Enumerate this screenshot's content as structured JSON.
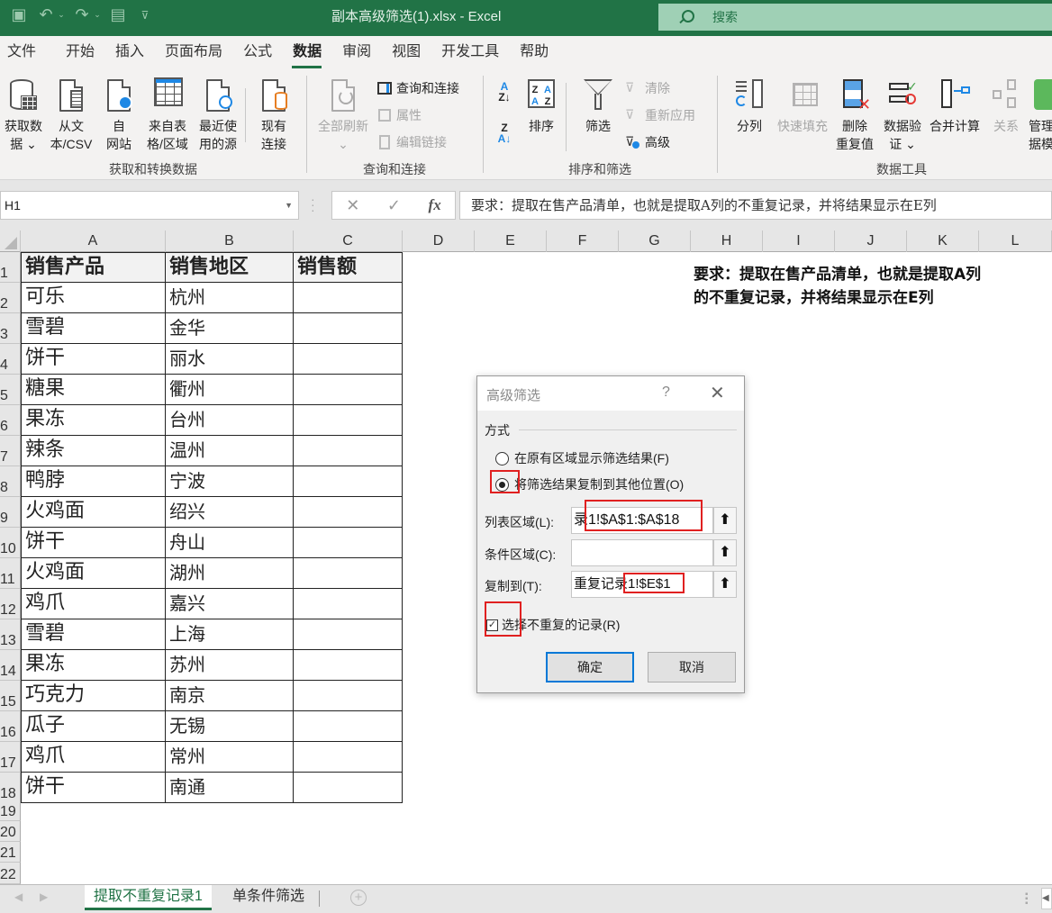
{
  "titlebar": {
    "title": "副本高级筛选(1).xlsx  -  Excel",
    "search_placeholder": "搜索",
    "qat": {
      "save": "save-icon",
      "undo": "undo-icon",
      "redo": "redo-icon",
      "form": "form-icon",
      "customize": "customize-qat-icon"
    }
  },
  "menu": {
    "tabs": [
      "文件",
      "开始",
      "插入",
      "页面布局",
      "公式",
      "数据",
      "审阅",
      "视图",
      "开发工具",
      "帮助"
    ],
    "active": "数据"
  },
  "ribbon": {
    "groups": [
      {
        "label": "获取和转换数据",
        "buttons": [
          {
            "line1": "获取数",
            "line2": "据 ⌄",
            "icon": "database-icon"
          },
          {
            "line1": "从文",
            "line2": "本/CSV",
            "icon": "text-file-icon"
          },
          {
            "line1": "自",
            "line2": "网站",
            "icon": "web-icon"
          },
          {
            "line1": "来自表",
            "line2": "格/区域",
            "icon": "table-icon"
          },
          {
            "line1": "最近使",
            "line2": "用的源",
            "icon": "recent-sources-icon"
          },
          {
            "line1": "现有",
            "line2": "连接",
            "icon": "existing-connections-icon"
          }
        ]
      },
      {
        "label": "查询和连接",
        "buttons": [
          {
            "line1": "全部刷新",
            "line2": "⌄",
            "icon": "refresh-all-icon",
            "disabled": true
          }
        ],
        "small": [
          {
            "label": "查询和连接",
            "icon": "queries-pane-icon",
            "disabled": false
          },
          {
            "label": "属性",
            "icon": "properties-icon",
            "disabled": true
          },
          {
            "label": "编辑链接",
            "icon": "edit-links-icon",
            "disabled": true
          }
        ]
      },
      {
        "label": "排序和筛选",
        "buttons": [
          {
            "line1": "排序",
            "line2": "",
            "icon": "sort-icon"
          },
          {
            "line1": "筛选",
            "line2": "",
            "icon": "filter-icon"
          }
        ],
        "small": [
          {
            "label": "清除",
            "icon": "clear-filter-icon",
            "disabled": true
          },
          {
            "label": "重新应用",
            "icon": "reapply-icon",
            "disabled": true
          },
          {
            "label": "高级",
            "icon": "advanced-filter-icon",
            "disabled": false
          }
        ],
        "sort_asc": "A→Z",
        "sort_desc": "Z→A"
      },
      {
        "label": "数据工具",
        "buttons": [
          {
            "line1": "分列",
            "line2": "",
            "icon": "text-to-columns-icon"
          },
          {
            "line1": "快速填充",
            "line2": "",
            "icon": "flash-fill-icon",
            "disabled": true
          },
          {
            "line1": "删除",
            "line2": "重复值",
            "icon": "remove-duplicates-icon"
          },
          {
            "line1": "数据验",
            "line2": "证 ⌄",
            "icon": "data-validation-icon"
          },
          {
            "line1": "合并计算",
            "line2": "",
            "icon": "consolidate-icon"
          },
          {
            "line1": "关系",
            "line2": "",
            "icon": "relationships-icon",
            "disabled": true
          },
          {
            "line1": "管理",
            "line2": "据模",
            "icon": "data-model-icon"
          }
        ]
      }
    ]
  },
  "formula_bar": {
    "name_box": "H1",
    "cancel": "✕",
    "enter": "✓",
    "fx": "fx",
    "content": "要求：提取在售产品清单，也就是提取A列的不重复记录，并将结果显示在E列"
  },
  "grid": {
    "columns": [
      "A",
      "B",
      "C",
      "D",
      "E",
      "F",
      "G",
      "H",
      "I",
      "J",
      "K",
      "L"
    ],
    "rows": [
      "1",
      "2",
      "3",
      "4",
      "5",
      "6",
      "7",
      "8",
      "9",
      "10",
      "11",
      "12",
      "13",
      "14",
      "15",
      "16",
      "17",
      "18",
      "19",
      "20",
      "21",
      "22"
    ],
    "header": [
      "销售产品",
      "销售地区",
      "销售额"
    ],
    "data": [
      [
        "可乐",
        "杭州",
        ""
      ],
      [
        "雪碧",
        "金华",
        ""
      ],
      [
        "饼干",
        "丽水",
        ""
      ],
      [
        "糖果",
        "衢州",
        ""
      ],
      [
        "果冻",
        "台州",
        ""
      ],
      [
        "辣条",
        "温州",
        ""
      ],
      [
        "鸭脖",
        "宁波",
        ""
      ],
      [
        "火鸡面",
        "绍兴",
        ""
      ],
      [
        "饼干",
        "舟山",
        ""
      ],
      [
        "火鸡面",
        "湖州",
        ""
      ],
      [
        "鸡爪",
        "嘉兴",
        ""
      ],
      [
        "雪碧",
        "上海",
        ""
      ],
      [
        "果冻",
        "苏州",
        ""
      ],
      [
        "巧克力",
        "南京",
        ""
      ],
      [
        "瓜子",
        "无锡",
        ""
      ],
      [
        "鸡爪",
        "常州",
        ""
      ],
      [
        "饼干",
        "南通",
        ""
      ]
    ],
    "note": "要求：提取在售产品清单，也就是提取A列的不重复记录，并将结果显示在E列"
  },
  "dialog": {
    "title": "高级筛选",
    "help": "?",
    "close": "✕",
    "section": "方式",
    "options": [
      {
        "label": "在原有区域显示筛选结果(F)",
        "selected": false
      },
      {
        "label": "将筛选结果复制到其他位置(O)",
        "selected": true
      }
    ],
    "fields": [
      {
        "label": "列表区域(L):",
        "value": "录1!$A$1:$A$18"
      },
      {
        "label": "条件区域(C):",
        "value": ""
      },
      {
        "label": "复制到(T):",
        "value": "重复记录1!$E$1"
      }
    ],
    "collapse_btn": "⬆",
    "unique_checkbox": {
      "label": "选择不重复的记录(R)",
      "checked": true
    },
    "ok": "确定",
    "cancel": "取消"
  },
  "sheets": {
    "tabs": [
      "提取不重复记录1",
      "单条件筛选"
    ],
    "active": "提取不重复记录1",
    "add": "+"
  }
}
